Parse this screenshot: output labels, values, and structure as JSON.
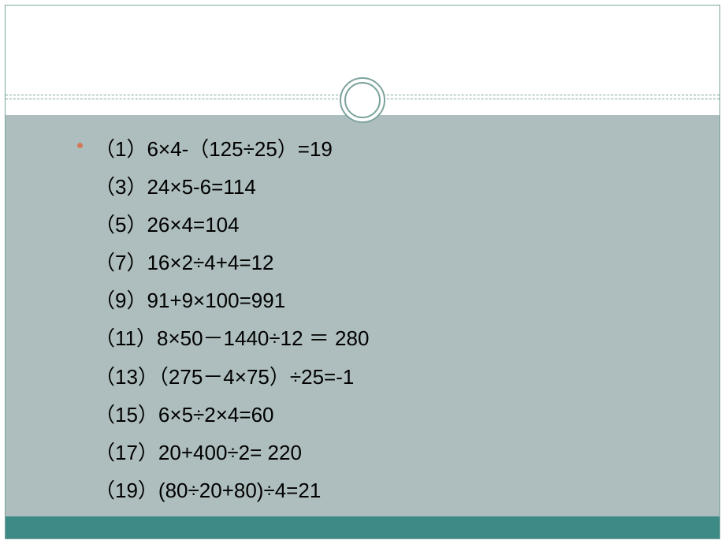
{
  "lines": [
    "（1）6×4-（125÷25）=19",
    "（3）24×5-6=114",
    "（5）26×4=104",
    "（7）16×2÷4+4=12",
    "（9）91+9×100=991",
    "（11）8×50－1440÷12 ＝ 280",
    "（13）（275－4×75）÷25=-1",
    "（15）6×5÷2×4=60",
    "（17）20+400÷2= 220",
    "（19）(80÷20+80)÷4=21"
  ],
  "watermark": "."
}
